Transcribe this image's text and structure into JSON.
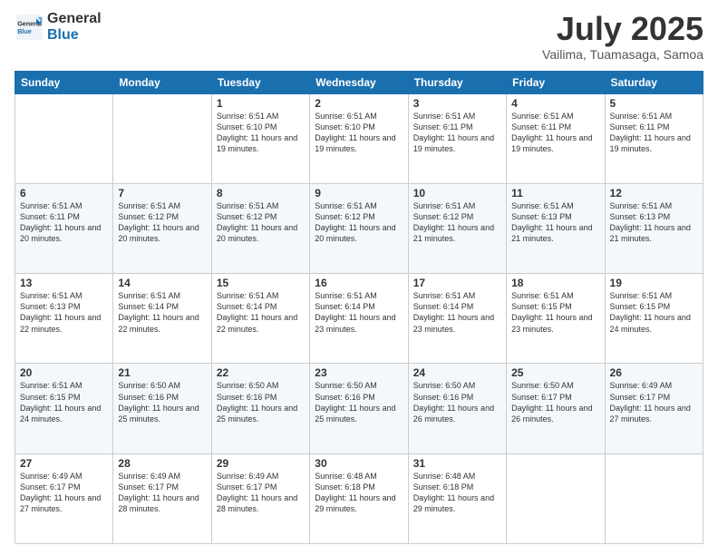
{
  "logo": {
    "line1": "General",
    "line2": "Blue"
  },
  "title": "July 2025",
  "subtitle": "Vailima, Tuamasaga, Samoa",
  "weekdays": [
    "Sunday",
    "Monday",
    "Tuesday",
    "Wednesday",
    "Thursday",
    "Friday",
    "Saturday"
  ],
  "weeks": [
    [
      {
        "day": "",
        "info": ""
      },
      {
        "day": "",
        "info": ""
      },
      {
        "day": "1",
        "info": "Sunrise: 6:51 AM\nSunset: 6:10 PM\nDaylight: 11 hours and 19 minutes."
      },
      {
        "day": "2",
        "info": "Sunrise: 6:51 AM\nSunset: 6:10 PM\nDaylight: 11 hours and 19 minutes."
      },
      {
        "day": "3",
        "info": "Sunrise: 6:51 AM\nSunset: 6:11 PM\nDaylight: 11 hours and 19 minutes."
      },
      {
        "day": "4",
        "info": "Sunrise: 6:51 AM\nSunset: 6:11 PM\nDaylight: 11 hours and 19 minutes."
      },
      {
        "day": "5",
        "info": "Sunrise: 6:51 AM\nSunset: 6:11 PM\nDaylight: 11 hours and 19 minutes."
      }
    ],
    [
      {
        "day": "6",
        "info": "Sunrise: 6:51 AM\nSunset: 6:11 PM\nDaylight: 11 hours and 20 minutes."
      },
      {
        "day": "7",
        "info": "Sunrise: 6:51 AM\nSunset: 6:12 PM\nDaylight: 11 hours and 20 minutes."
      },
      {
        "day": "8",
        "info": "Sunrise: 6:51 AM\nSunset: 6:12 PM\nDaylight: 11 hours and 20 minutes."
      },
      {
        "day": "9",
        "info": "Sunrise: 6:51 AM\nSunset: 6:12 PM\nDaylight: 11 hours and 20 minutes."
      },
      {
        "day": "10",
        "info": "Sunrise: 6:51 AM\nSunset: 6:12 PM\nDaylight: 11 hours and 21 minutes."
      },
      {
        "day": "11",
        "info": "Sunrise: 6:51 AM\nSunset: 6:13 PM\nDaylight: 11 hours and 21 minutes."
      },
      {
        "day": "12",
        "info": "Sunrise: 6:51 AM\nSunset: 6:13 PM\nDaylight: 11 hours and 21 minutes."
      }
    ],
    [
      {
        "day": "13",
        "info": "Sunrise: 6:51 AM\nSunset: 6:13 PM\nDaylight: 11 hours and 22 minutes."
      },
      {
        "day": "14",
        "info": "Sunrise: 6:51 AM\nSunset: 6:14 PM\nDaylight: 11 hours and 22 minutes."
      },
      {
        "day": "15",
        "info": "Sunrise: 6:51 AM\nSunset: 6:14 PM\nDaylight: 11 hours and 22 minutes."
      },
      {
        "day": "16",
        "info": "Sunrise: 6:51 AM\nSunset: 6:14 PM\nDaylight: 11 hours and 23 minutes."
      },
      {
        "day": "17",
        "info": "Sunrise: 6:51 AM\nSunset: 6:14 PM\nDaylight: 11 hours and 23 minutes."
      },
      {
        "day": "18",
        "info": "Sunrise: 6:51 AM\nSunset: 6:15 PM\nDaylight: 11 hours and 23 minutes."
      },
      {
        "day": "19",
        "info": "Sunrise: 6:51 AM\nSunset: 6:15 PM\nDaylight: 11 hours and 24 minutes."
      }
    ],
    [
      {
        "day": "20",
        "info": "Sunrise: 6:51 AM\nSunset: 6:15 PM\nDaylight: 11 hours and 24 minutes."
      },
      {
        "day": "21",
        "info": "Sunrise: 6:50 AM\nSunset: 6:16 PM\nDaylight: 11 hours and 25 minutes."
      },
      {
        "day": "22",
        "info": "Sunrise: 6:50 AM\nSunset: 6:16 PM\nDaylight: 11 hours and 25 minutes."
      },
      {
        "day": "23",
        "info": "Sunrise: 6:50 AM\nSunset: 6:16 PM\nDaylight: 11 hours and 25 minutes."
      },
      {
        "day": "24",
        "info": "Sunrise: 6:50 AM\nSunset: 6:16 PM\nDaylight: 11 hours and 26 minutes."
      },
      {
        "day": "25",
        "info": "Sunrise: 6:50 AM\nSunset: 6:17 PM\nDaylight: 11 hours and 26 minutes."
      },
      {
        "day": "26",
        "info": "Sunrise: 6:49 AM\nSunset: 6:17 PM\nDaylight: 11 hours and 27 minutes."
      }
    ],
    [
      {
        "day": "27",
        "info": "Sunrise: 6:49 AM\nSunset: 6:17 PM\nDaylight: 11 hours and 27 minutes."
      },
      {
        "day": "28",
        "info": "Sunrise: 6:49 AM\nSunset: 6:17 PM\nDaylight: 11 hours and 28 minutes."
      },
      {
        "day": "29",
        "info": "Sunrise: 6:49 AM\nSunset: 6:17 PM\nDaylight: 11 hours and 28 minutes."
      },
      {
        "day": "30",
        "info": "Sunrise: 6:48 AM\nSunset: 6:18 PM\nDaylight: 11 hours and 29 minutes."
      },
      {
        "day": "31",
        "info": "Sunrise: 6:48 AM\nSunset: 6:18 PM\nDaylight: 11 hours and 29 minutes."
      },
      {
        "day": "",
        "info": ""
      },
      {
        "day": "",
        "info": ""
      }
    ]
  ]
}
